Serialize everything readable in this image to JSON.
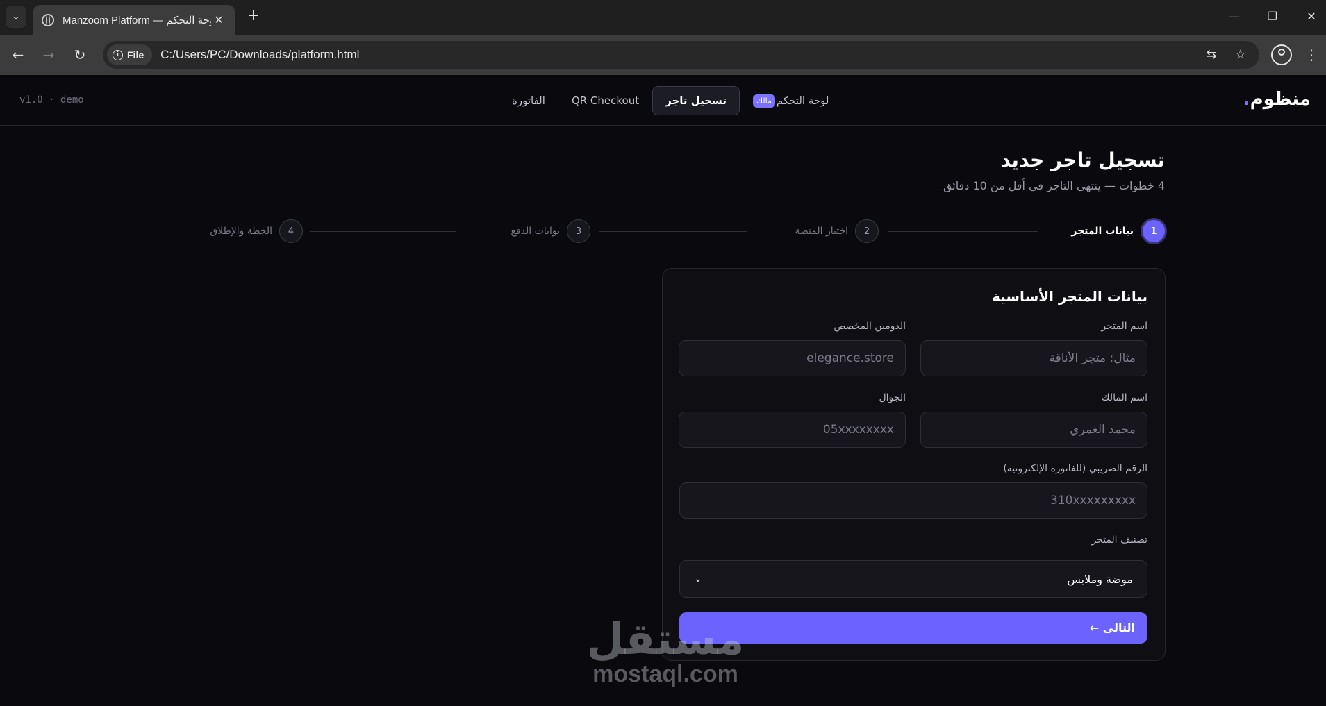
{
  "browser": {
    "tab_title": "Manzoom Platform — لوحة التحكم",
    "file_chip": "File",
    "url": "C:/Users/PC/Downloads/platform.html"
  },
  "app": {
    "version": "v1.0 · demo",
    "brand": "منظوم",
    "brand_dot": ".",
    "nav": {
      "dashboard": "لوحة التحكم",
      "owner_badge": "مالك",
      "register": "تسجيل تاجر",
      "qr": "QR Checkout",
      "invoice": "الفاتورة"
    }
  },
  "page": {
    "title": "تسجيل تاجر جديد",
    "subtitle": "4 خطوات — ينتهي التاجر في أقل من 10 دقائق"
  },
  "steps": [
    {
      "num": "1",
      "label": "بيانات المتجر"
    },
    {
      "num": "2",
      "label": "اختيار المنصة"
    },
    {
      "num": "3",
      "label": "بوابات الدفع"
    },
    {
      "num": "4",
      "label": "الخطة والإطلاق"
    }
  ],
  "form": {
    "title": "بيانات المتجر الأساسية",
    "store_name": {
      "label": "اسم المتجر",
      "placeholder": "مثال: متجر الأناقة"
    },
    "domain": {
      "label": "الدومين المخصص",
      "placeholder": "elegance.store"
    },
    "owner": {
      "label": "اسم المالك",
      "placeholder": "محمد العمري"
    },
    "phone": {
      "label": "الجوال",
      "placeholder": "05xxxxxxxx"
    },
    "tax": {
      "label": "الرقم الضريبي (للفاتورة الإلكترونية)",
      "placeholder": "310xxxxxxxxx"
    },
    "category": {
      "label": "تصنيف المتجر",
      "value": "موضة وملابس"
    },
    "next": "التالي ←"
  },
  "watermark": {
    "ar": "مستقل",
    "en": "mostaql.com"
  }
}
